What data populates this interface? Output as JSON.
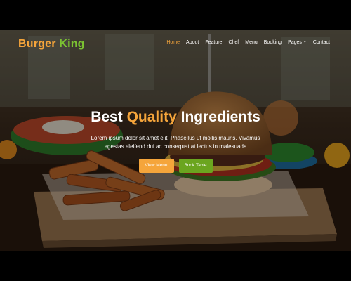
{
  "brand": {
    "word1": "Burger",
    "word2": "King"
  },
  "nav": {
    "items": [
      {
        "label": "Home",
        "active": true
      },
      {
        "label": "About",
        "active": false
      },
      {
        "label": "Feature",
        "active": false
      },
      {
        "label": "Chef",
        "active": false
      },
      {
        "label": "Menu",
        "active": false
      },
      {
        "label": "Booking",
        "active": false
      },
      {
        "label": "Pages",
        "active": false,
        "dropdown": true
      },
      {
        "label": "Contact",
        "active": false
      }
    ]
  },
  "hero": {
    "headline_before": "Best",
    "headline_accent": "Quality",
    "headline_after": "Ingredients",
    "lead_line1": "Lorem ipsum dolor sit amet elit. Phasellus ut mollis mauris. Vivamus",
    "lead_line2": "egestas eleifend dui ac consequat at lectus in malesuada",
    "button_primary": "View Menu",
    "button_secondary": "Book Table"
  },
  "colors": {
    "accent": "#f5a53b",
    "green": "#6ba51f"
  }
}
